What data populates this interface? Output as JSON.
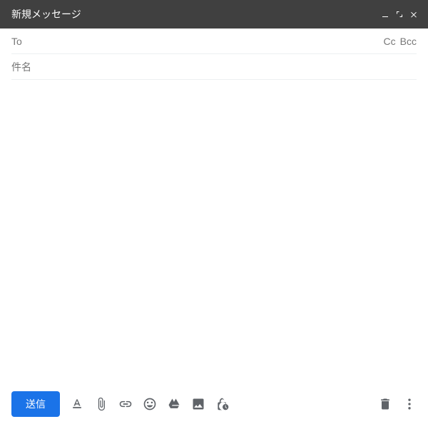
{
  "titlebar": {
    "title": "新規メッセージ"
  },
  "fields": {
    "to_label": "To",
    "to_value": "",
    "cc_label": "Cc",
    "bcc_label": "Bcc",
    "subject_placeholder": "件名",
    "subject_value": ""
  },
  "body": {
    "content": ""
  },
  "toolbar": {
    "send_label": "送信"
  }
}
